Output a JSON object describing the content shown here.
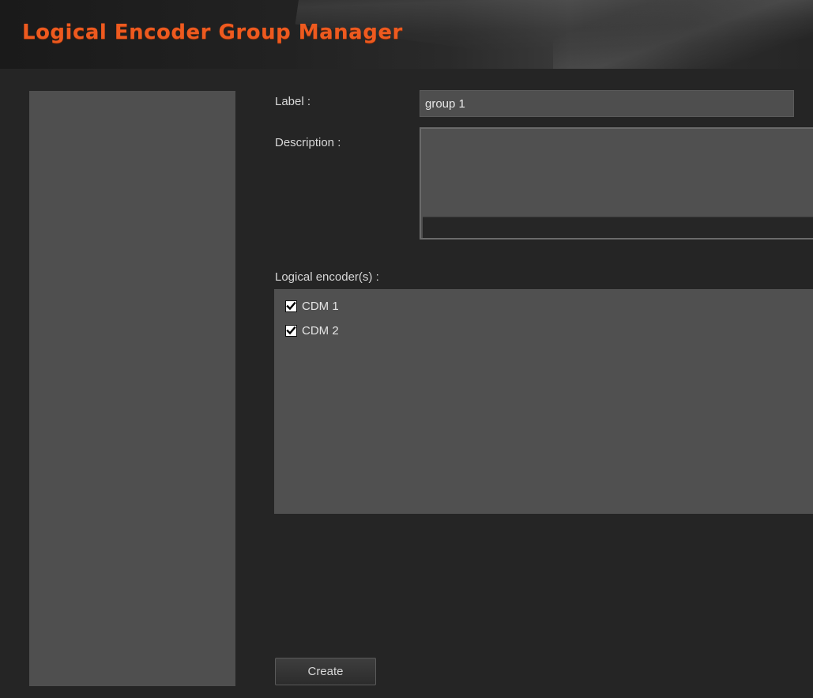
{
  "window": {
    "title": "Logical Encoder Group Manager",
    "accent_color": "#ee5a1f"
  },
  "form": {
    "label_caption": "Label :",
    "label_value": "group 1",
    "description_caption": "Description :",
    "description_value": "",
    "encoders_caption": "Logical encoder(s) :",
    "encoders": [
      {
        "label": "CDM 1",
        "checked": true
      },
      {
        "label": "CDM 2",
        "checked": true
      }
    ],
    "create_label": "Create"
  },
  "icons": {
    "checkbox_checked": "checkmark-icon"
  }
}
